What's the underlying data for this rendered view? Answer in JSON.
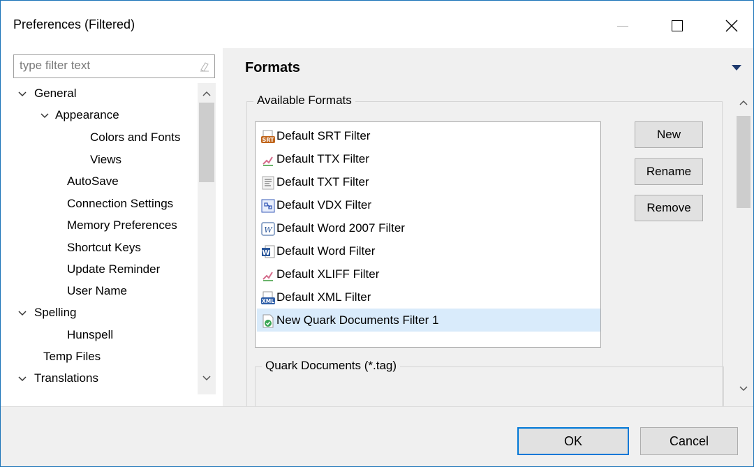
{
  "window": {
    "title": "Preferences (Filtered)"
  },
  "filter": {
    "placeholder": "type filter text"
  },
  "tree": {
    "items": [
      {
        "label": "General",
        "expanded": true
      },
      {
        "label": "Appearance",
        "expanded": true
      },
      {
        "label": "Colors and Fonts"
      },
      {
        "label": "Views"
      },
      {
        "label": "AutoSave"
      },
      {
        "label": "Connection Settings"
      },
      {
        "label": "Memory Preferences"
      },
      {
        "label": "Shortcut Keys"
      },
      {
        "label": "Update Reminder"
      },
      {
        "label": "User Name"
      },
      {
        "label": "Spelling",
        "expanded": true
      },
      {
        "label": "Hunspell"
      },
      {
        "label": "Temp Files"
      },
      {
        "label": "Translations",
        "expanded": true
      }
    ]
  },
  "page": {
    "title": "Formats",
    "available_formats_label": "Available Formats",
    "formats": [
      {
        "label": "Default SRT Filter",
        "icon": "srt-icon"
      },
      {
        "label": "Default TTX Filter",
        "icon": "ttx-icon"
      },
      {
        "label": "Default TXT Filter",
        "icon": "txt-icon"
      },
      {
        "label": "Default VDX Filter",
        "icon": "vdx-icon"
      },
      {
        "label": "Default Word 2007 Filter",
        "icon": "word2007-icon"
      },
      {
        "label": "Default Word Filter",
        "icon": "word-icon"
      },
      {
        "label": "Default XLIFF Filter",
        "icon": "xliff-icon"
      },
      {
        "label": "Default XML Filter",
        "icon": "xml-icon"
      },
      {
        "label": "New Quark Documents Filter 1",
        "icon": "quark-icon",
        "selected": true
      }
    ],
    "buttons": {
      "new": "New",
      "rename": "Rename",
      "remove": "Remove"
    },
    "details_label": "Quark Documents (*.tag)"
  },
  "dialog": {
    "ok": "OK",
    "cancel": "Cancel"
  },
  "colors": {
    "accent": "#0078d7",
    "selection": "#d9ebfb"
  }
}
